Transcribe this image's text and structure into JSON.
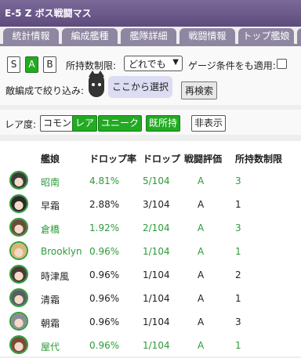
{
  "title": "E-5 Z ボス戦闘マス",
  "tabs": [
    "統計情報",
    "編成艦種",
    "艦隊詳細",
    "戦闘情報",
    "トップ艦娘"
  ],
  "rank_buttons": [
    {
      "label": "S",
      "active": false
    },
    {
      "label": "A",
      "active": true
    },
    {
      "label": "B",
      "active": false
    }
  ],
  "limit_label": "所持数制限:",
  "limit_value": "どれでも",
  "gauge_label": "ゲージ条件をも適用:",
  "filter_label": "敵編成で絞り込み:",
  "select_here": "ここから選択",
  "research": "再検索",
  "rarity_label": "レア度:",
  "rarity_buttons": [
    {
      "label": "コモン",
      "active": false
    },
    {
      "label": "レア",
      "active": true
    },
    {
      "label": "ユニーク",
      "active": true
    },
    {
      "label": "既所持",
      "active": true
    },
    {
      "label": "非表示",
      "active": false
    }
  ],
  "headers": [
    "艦娘",
    "ドロップ率",
    "ドロップ",
    "戦闘評価",
    "所持数制限"
  ],
  "rows": [
    {
      "name": "昭南",
      "rate": "4.81%",
      "drop": "5/104",
      "rank": "A",
      "limit": "3",
      "green": true,
      "hair": "#3b3b3b"
    },
    {
      "name": "早霜",
      "rate": "2.88%",
      "drop": "3/104",
      "rank": "A",
      "limit": "1",
      "green": false,
      "hair": "#2a2a2a"
    },
    {
      "name": "倉橋",
      "rate": "1.92%",
      "drop": "2/104",
      "rank": "A",
      "limit": "3",
      "green": true,
      "hair": "#6b4b3a"
    },
    {
      "name": "Brooklyn",
      "rate": "0.96%",
      "drop": "1/104",
      "rank": "A",
      "limit": "1",
      "green": true,
      "hair": "#d8b67a"
    },
    {
      "name": "時津風",
      "rate": "0.96%",
      "drop": "1/104",
      "rank": "A",
      "limit": "2",
      "green": false,
      "hair": "#4a3a34"
    },
    {
      "name": "清霜",
      "rate": "0.96%",
      "drop": "1/104",
      "rank": "A",
      "limit": "1",
      "green": false,
      "hair": "#5a5e64"
    },
    {
      "name": "朝霜",
      "rate": "0.96%",
      "drop": "1/104",
      "rank": "A",
      "limit": "3",
      "green": false,
      "hair": "#8c8c96"
    },
    {
      "name": "屋代",
      "rate": "0.96%",
      "drop": "1/104",
      "rank": "A",
      "limit": "1",
      "green": true,
      "hair": "#7a4a3a"
    }
  ]
}
